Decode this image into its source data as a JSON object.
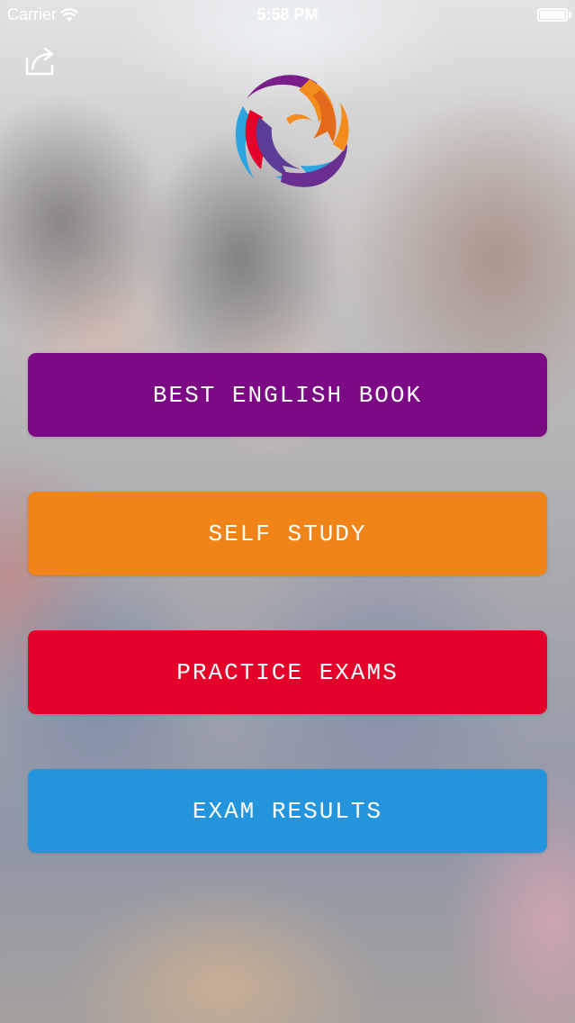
{
  "status_bar": {
    "carrier": "Carrier",
    "time": "5:58 PM",
    "icons": [
      "wifi-icon",
      "battery-icon"
    ]
  },
  "header": {
    "share_icon": "share-icon",
    "logo_icon": "swirl-logo-icon"
  },
  "menu": {
    "items": [
      {
        "label": "BEST ENGLISH BOOK",
        "color": "#7c0a84"
      },
      {
        "label": "SELF STUDY",
        "color": "#f08418"
      },
      {
        "label": "PRACTICE EXAMS",
        "color": "#e4022a"
      },
      {
        "label": "EXAM RESULTS",
        "color": "#2495dc"
      }
    ]
  },
  "logo_colors": [
    "#7a1f8a",
    "#f28c1c",
    "#e4022a",
    "#2aa5e0",
    "#6a2f90"
  ]
}
